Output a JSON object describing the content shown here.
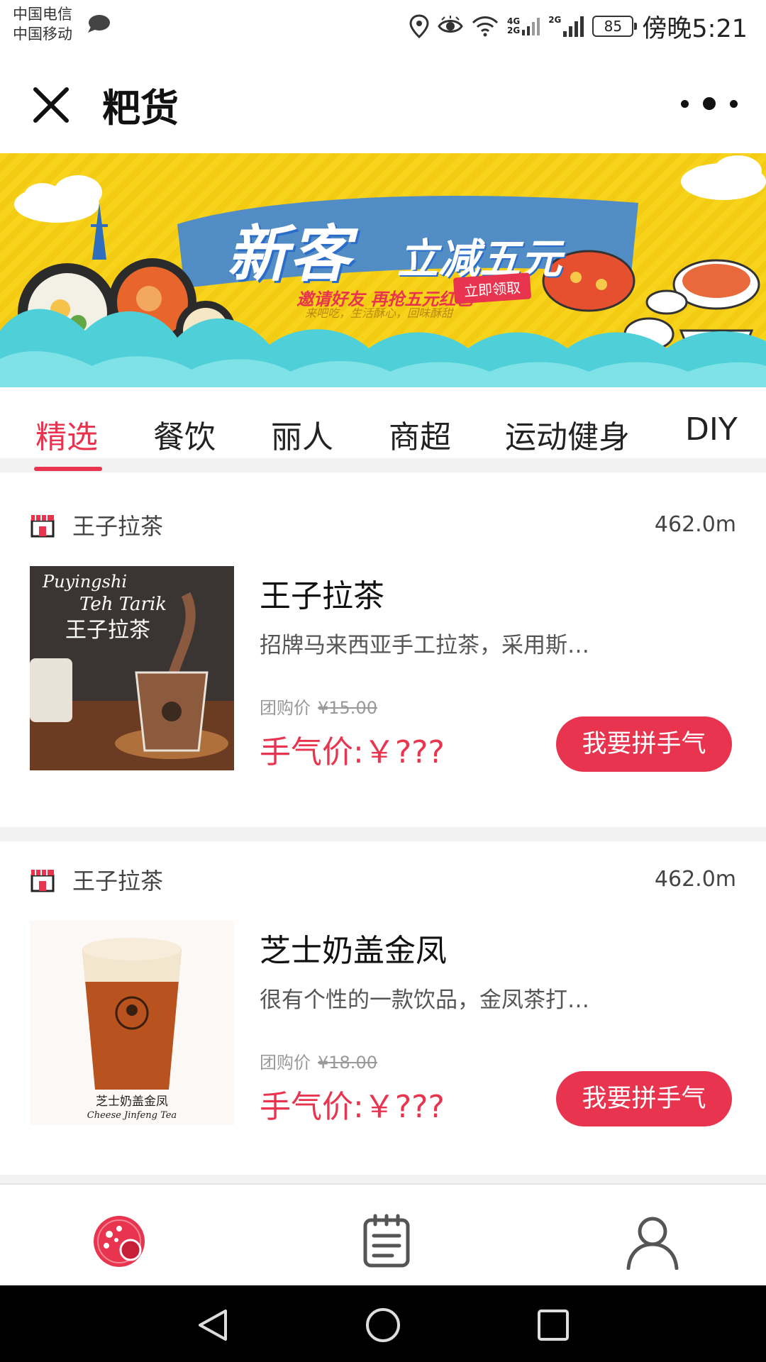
{
  "status_bar": {
    "carrier_1": "中国电信",
    "carrier_2": "中国移动",
    "network_1": "4G",
    "network_2": "2G",
    "network_3": "2G",
    "battery": "85",
    "time": "傍晚5:21"
  },
  "header": {
    "title": "粑货",
    "close_icon": "close-icon",
    "more_icon": "more-icon"
  },
  "banner": {
    "headline": "新客",
    "subhead": "立减五元",
    "tagline": "邀请好友 再抢五元红包",
    "cta": "立即领取",
    "fine_print": "来吧吃，生活酥心，回味酥甜"
  },
  "tabs": [
    {
      "label": "精选",
      "active": true
    },
    {
      "label": "餐饮",
      "active": false
    },
    {
      "label": "丽人",
      "active": false
    },
    {
      "label": "商超",
      "active": false
    },
    {
      "label": "运动健身",
      "active": false
    },
    {
      "label": "DIY",
      "active": false
    }
  ],
  "products": [
    {
      "shop_name": "王子拉茶",
      "distance": "462.0m",
      "name": "王子拉茶",
      "description": "招牌马来西亚手工拉茶，采用斯…",
      "group_label": "团购价",
      "group_price": "¥15.00",
      "luck_price": "手气价:￥???",
      "button": "我要拼手气",
      "image_text_1": "Puyingshi",
      "image_text_2": "Teh Tarik",
      "image_text_3": "王子拉茶"
    },
    {
      "shop_name": "王子拉茶",
      "distance": "462.0m",
      "name": "芝士奶盖金凤",
      "description": "很有个性的一款饮品，金凤茶打…",
      "group_label": "团购价",
      "group_price": "¥18.00",
      "luck_price": "手气价:￥???",
      "button": "我要拼手气",
      "image_text_1": "芝士奶盖金凤",
      "image_text_2": "Cheese Jinfeng Tea"
    }
  ],
  "bottom_nav": {
    "items": [
      "home-icon",
      "orders-icon",
      "profile-icon"
    ],
    "active_color": "#e8344e"
  },
  "colors": {
    "accent": "#e8344e",
    "banner_yellow": "#f7d31c",
    "wave_teal": "#4fd0d8"
  }
}
